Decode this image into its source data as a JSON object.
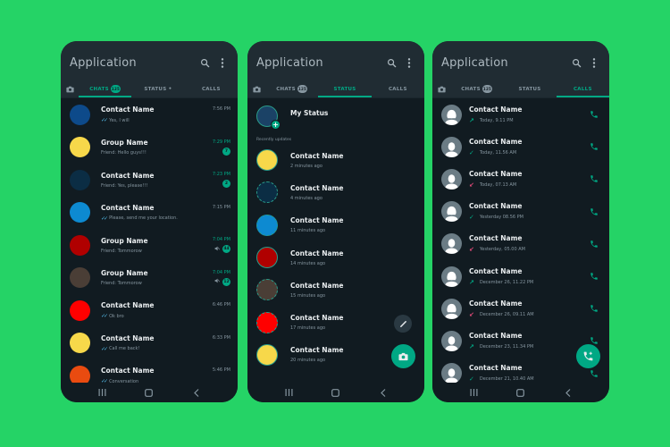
{
  "app": {
    "title": "Application",
    "colors": {
      "background": "#25d366",
      "phone_bg": "#111b21",
      "header_bg": "#202c33",
      "accent": "#00a884",
      "text_primary": "#e9edef",
      "text_secondary": "#8696a0",
      "missed": "#ea4c7d"
    }
  },
  "icons": {
    "search": "search-icon",
    "menu": "more-vert-icon",
    "camera": "camera-icon",
    "nav_recent": "recent-apps-icon",
    "nav_home": "home-icon",
    "nav_back": "back-icon"
  },
  "screens": [
    {
      "tabs": [
        {
          "label": "CHATS",
          "badge": "125",
          "active": true
        },
        {
          "label": "STATUS",
          "dot": "•",
          "active": false
        },
        {
          "label": "CALLS",
          "active": false
        }
      ]
    },
    {
      "tabs": [
        {
          "label": "CHATS",
          "badge": "125",
          "active": false
        },
        {
          "label": "STATUS",
          "active": true
        },
        {
          "label": "CALLS",
          "active": false
        }
      ]
    },
    {
      "tabs": [
        {
          "label": "CHATS",
          "badge": "125",
          "active": false
        },
        {
          "label": "STATUS",
          "active": false
        },
        {
          "label": "CALLS",
          "active": true
        }
      ]
    }
  ],
  "chats": [
    {
      "name": "Contact Name",
      "message": "Yes, I will",
      "time": "7:56 PM",
      "color": "#0d4a8a",
      "ticks": true,
      "unread": null,
      "muted": false
    },
    {
      "name": "Group Name",
      "message": "Friend: Hello guys!!!",
      "time": "7:29 PM",
      "color": "#f7d84a",
      "ticks": false,
      "unread": "7",
      "muted": false
    },
    {
      "name": "Contact Name",
      "message": "Friend: Yes, please!!!",
      "time": "7:23 PM",
      "color": "#0b2d44",
      "ticks": false,
      "unread": "2",
      "muted": false
    },
    {
      "name": "Contact Name",
      "message": "Please, send me your location.",
      "time": "7:15 PM",
      "color": "#0d8ad1",
      "ticks": true,
      "unread": null,
      "muted": false
    },
    {
      "name": "Group Name",
      "message": "Friend: Tommorow",
      "time": "7:04 PM",
      "color": "#b00000",
      "ticks": false,
      "unread": "44",
      "muted": true
    },
    {
      "name": "Group Name",
      "message": "Friend: Tommorow",
      "time": "7:04 PM",
      "color": "#4a3e36",
      "ticks": false,
      "unread": "12",
      "muted": true
    },
    {
      "name": "Contact Name",
      "message": "Ok bro",
      "time": "6:46 PM",
      "color": "#ff0000",
      "ticks": true,
      "unread": null,
      "muted": false
    },
    {
      "name": "Contact Name",
      "message": "Call me back!",
      "time": "6:33 PM",
      "color": "#f7d84a",
      "ticks": true,
      "unread": null,
      "muted": false
    },
    {
      "name": "Contact Name",
      "message": "Conversation",
      "time": "5:46 PM",
      "color": "#e94b10",
      "ticks": true,
      "unread": null,
      "muted": false
    }
  ],
  "status": {
    "my_status_label": "My Status",
    "add_symbol": "+",
    "section_label": "Recently updates",
    "items": [
      {
        "name": "Contact Name",
        "time": "2 minutes ago",
        "color": "#f7d84a",
        "seen": false
      },
      {
        "name": "Contact Name",
        "time": "4 minutes ago",
        "color": "#0b2d44",
        "seen": true
      },
      {
        "name": "Contact Name",
        "time": "11 minutes ago",
        "color": "#0d8ad1",
        "seen": true
      },
      {
        "name": "Contact Name",
        "time": "14 minutes ago",
        "color": "#b00000",
        "seen": false
      },
      {
        "name": "Contact Name",
        "time": "15 minutes ago",
        "color": "#4a3e36",
        "seen": true
      },
      {
        "name": "Contact Name",
        "time": "17 minutes ago",
        "color": "#ff0000",
        "seen": true
      },
      {
        "name": "Contact Name",
        "time": "20 minutes ago",
        "color": "#f7d84a",
        "seen": false
      }
    ]
  },
  "calls": [
    {
      "name": "Contact Name",
      "time": "Today, 9.11 PM",
      "type": "out",
      "avatar": "female"
    },
    {
      "name": "Contact Name",
      "time": "Today, 11.56 AM",
      "type": "in",
      "avatar": "male"
    },
    {
      "name": "Contact Name",
      "time": "Today, 07.13 AM",
      "type": "missed",
      "avatar": "male"
    },
    {
      "name": "Contact Name",
      "time": "Yesterday 08.56 PM",
      "type": "in",
      "avatar": "female"
    },
    {
      "name": "Contact Name",
      "time": "Yesterday, 05.00 AM",
      "type": "missed",
      "avatar": "male"
    },
    {
      "name": "Contact Name",
      "time": "December 26, 11.22 PM",
      "type": "out",
      "avatar": "female"
    },
    {
      "name": "Contact Name",
      "time": "December 26, 09.11 AM",
      "type": "missed",
      "avatar": "female"
    },
    {
      "name": "Contact Name",
      "time": "December 23, 11.34 PM",
      "type": "out",
      "avatar": "male"
    },
    {
      "name": "Contact Name",
      "time": "December 21, 10.40 AM",
      "type": "in",
      "avatar": "male"
    }
  ]
}
